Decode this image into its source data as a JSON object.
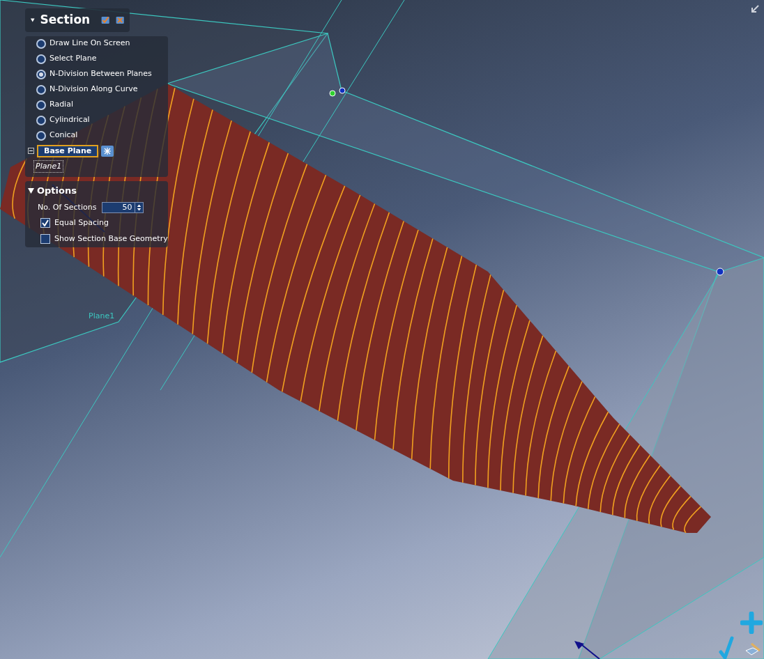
{
  "panel": {
    "title": "Section",
    "methods": [
      {
        "label": "Draw Line On Screen",
        "selected": false
      },
      {
        "label": "Select Plane",
        "selected": false
      },
      {
        "label": "N-Division Between Planes",
        "selected": true
      },
      {
        "label": "N-Division Along Curve",
        "selected": false
      },
      {
        "label": "Radial",
        "selected": false
      },
      {
        "label": "Cylindrical",
        "selected": false
      },
      {
        "label": "Conical",
        "selected": false
      }
    ],
    "base_plane": {
      "label": "Base Plane",
      "value": "Plane1"
    },
    "options": {
      "title": "Options",
      "sections_label": "No. Of Sections",
      "sections_value": "50",
      "toggles": [
        {
          "label": "Equal Spacing",
          "checked": true
        },
        {
          "label": "Show Section Base Geometry",
          "checked": false
        }
      ]
    }
  },
  "viewport": {
    "plane_label": "Plane1"
  }
}
